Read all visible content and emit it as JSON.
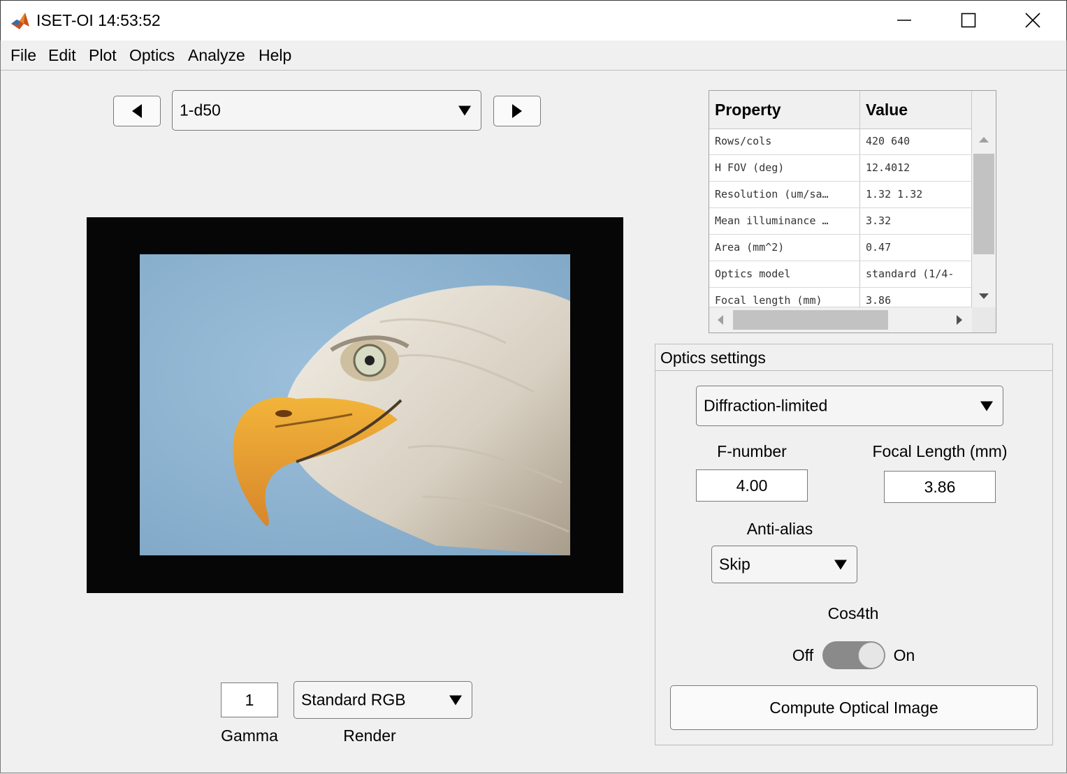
{
  "window": {
    "title": "ISET-OI 14:53:52",
    "icon": "matlab-icon"
  },
  "menu": [
    "File",
    "Edit",
    "Plot",
    "Optics",
    "Analyze",
    "Help"
  ],
  "nav": {
    "selector_value": "1-d50",
    "prev_icon": "triangle-left-icon",
    "next_icon": "triangle-right-icon"
  },
  "image": {
    "description_icon": "eagle-image"
  },
  "display": {
    "gamma_value": "1",
    "gamma_label": "Gamma",
    "render_value": "Standard RGB",
    "render_label": "Render"
  },
  "properties_table": {
    "headers": [
      "Property",
      "Value"
    ],
    "rows": [
      [
        "Rows/cols",
        "420 640"
      ],
      [
        "H FOV (deg)",
        "12.4012"
      ],
      [
        "Resolution (um/sa…",
        "1.32 1.32"
      ],
      [
        "Mean illuminance …",
        "3.32"
      ],
      [
        "Area (mm^2)",
        "0.47"
      ],
      [
        "Optics model",
        "standard (1/4-"
      ],
      [
        "Focal length (mm)",
        "3.86"
      ]
    ]
  },
  "optics": {
    "panel_title": "Optics settings",
    "model_value": "Diffraction-limited",
    "fnumber_label": "F-number",
    "fnumber_value": "4.00",
    "focal_label": "Focal Length (mm)",
    "focal_value": "3.86",
    "antialias_label": "Anti-alias",
    "antialias_value": "Skip",
    "cos4th_label": "Cos4th",
    "cos4th_off": "Off",
    "cos4th_on": "On",
    "cos4th_state": "On",
    "compute_label": "Compute Optical Image"
  },
  "colors": {
    "background": "#f0f0f0",
    "sky": "#8fb4d0",
    "beak": "#e8a030"
  }
}
